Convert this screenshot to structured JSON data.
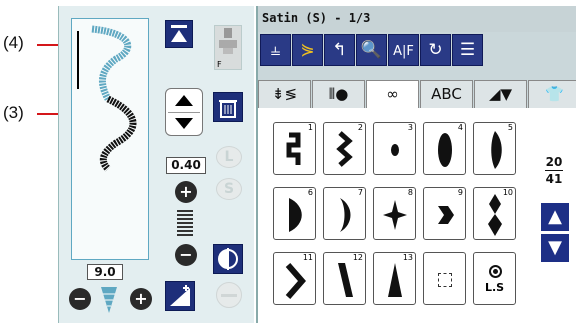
{
  "callouts": {
    "c4": "(4)",
    "c3": "(3)"
  },
  "title": "Satin (S) - 1/3",
  "left": {
    "width_value": "0.40",
    "length_value": "9.0",
    "presser_foot_label": "F",
    "ghost_L": "L",
    "ghost_S": "S"
  },
  "tabs": [
    {
      "label": "⇟≶",
      "active": false
    },
    {
      "label": "⦀●",
      "active": false
    },
    {
      "label": "∞",
      "active": true
    },
    {
      "label": "ABC",
      "active": false
    },
    {
      "label": "◢▼",
      "active": false
    },
    {
      "label": "👕",
      "active": false
    }
  ],
  "stitches": [
    {
      "num": "1"
    },
    {
      "num": "2"
    },
    {
      "num": "3"
    },
    {
      "num": "4"
    },
    {
      "num": "5"
    },
    {
      "num": "6"
    },
    {
      "num": "7"
    },
    {
      "num": "8"
    },
    {
      "num": "9"
    },
    {
      "num": "10"
    },
    {
      "num": "11"
    },
    {
      "num": "12"
    },
    {
      "num": "13"
    }
  ],
  "ls_label": "L.S",
  "page": {
    "current": "20",
    "total": "41"
  },
  "colors": {
    "navy": "#1e2f7a",
    "panel": "#e3eef0",
    "accent": "#5fa8c2",
    "callout_line": "#d4161a"
  }
}
